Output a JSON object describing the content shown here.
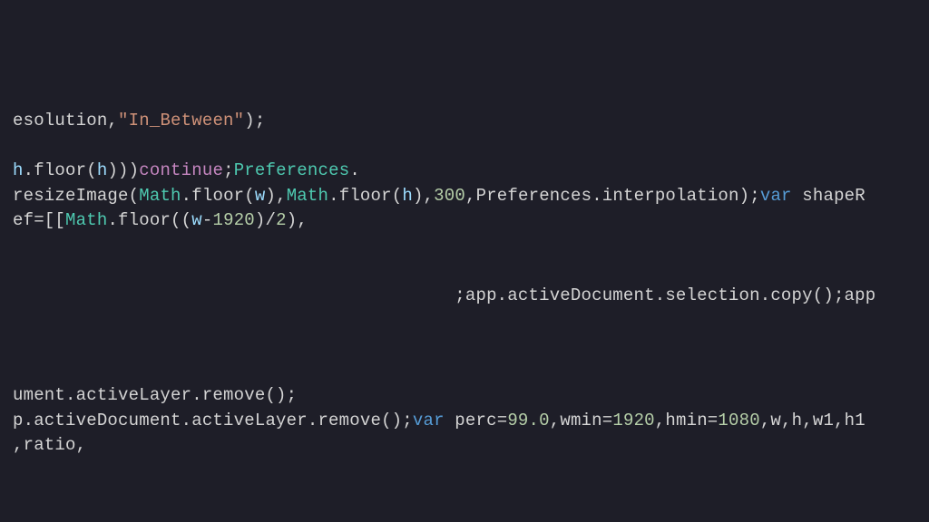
{
  "editor": {
    "lines": [
      {
        "segments": [
          {
            "cls": "tk-default",
            "text": "esolution,"
          },
          {
            "cls": "tk-string",
            "text": "\"In_Between\""
          },
          {
            "cls": "tk-default",
            "text": ");"
          }
        ]
      },
      {
        "segments": [
          {
            "cls": "tk-default",
            "text": " "
          }
        ]
      },
      {
        "segments": [
          {
            "cls": "tk-ident",
            "text": "h"
          },
          {
            "cls": "tk-default",
            "text": ".floor("
          },
          {
            "cls": "tk-ident",
            "text": "h"
          },
          {
            "cls": "tk-default",
            "text": ")))"
          },
          {
            "cls": "tk-keyword",
            "text": "continue"
          },
          {
            "cls": "tk-default",
            "text": ";"
          },
          {
            "cls": "tk-type",
            "text": "Preferences"
          },
          {
            "cls": "tk-default",
            "text": "."
          }
        ]
      },
      {
        "segments": [
          {
            "cls": "tk-default",
            "text": "resizeImage("
          },
          {
            "cls": "tk-type",
            "text": "Math"
          },
          {
            "cls": "tk-default",
            "text": ".floor("
          },
          {
            "cls": "tk-ident",
            "text": "w"
          },
          {
            "cls": "tk-default",
            "text": "),"
          },
          {
            "cls": "tk-type",
            "text": "Math"
          },
          {
            "cls": "tk-default",
            "text": ".floor("
          },
          {
            "cls": "tk-ident",
            "text": "h"
          },
          {
            "cls": "tk-default",
            "text": "),"
          },
          {
            "cls": "tk-number",
            "text": "300"
          },
          {
            "cls": "tk-default",
            "text": ",Preferences.interpolation);"
          },
          {
            "cls": "tk-var",
            "text": "var"
          },
          {
            "cls": "tk-default",
            "text": " shapeR"
          }
        ]
      },
      {
        "segments": [
          {
            "cls": "tk-default",
            "text": "ef=[["
          },
          {
            "cls": "tk-type",
            "text": "Math"
          },
          {
            "cls": "tk-default",
            "text": ".floor(("
          },
          {
            "cls": "tk-ident",
            "text": "w"
          },
          {
            "cls": "tk-default",
            "text": "-"
          },
          {
            "cls": "tk-number",
            "text": "1920"
          },
          {
            "cls": "tk-default",
            "text": ")/"
          },
          {
            "cls": "tk-number",
            "text": "2"
          },
          {
            "cls": "tk-default",
            "text": "),"
          }
        ]
      },
      {
        "segments": [
          {
            "cls": "tk-default",
            "text": " "
          }
        ]
      },
      {
        "segments": [
          {
            "cls": "tk-default",
            "text": " "
          }
        ]
      },
      {
        "segments": [
          {
            "cls": "tk-default",
            "text": "                                          ;app.activeDocument.selection.copy();app"
          }
        ]
      },
      {
        "segments": [
          {
            "cls": "tk-default",
            "text": " "
          }
        ]
      },
      {
        "segments": [
          {
            "cls": "tk-default",
            "text": " "
          }
        ]
      },
      {
        "segments": [
          {
            "cls": "tk-default",
            "text": " "
          }
        ]
      },
      {
        "segments": [
          {
            "cls": "tk-default",
            "text": "ument.activeLayer.remove();"
          }
        ]
      },
      {
        "segments": [
          {
            "cls": "tk-default",
            "text": "p.activeDocument.activeLayer.remove();"
          },
          {
            "cls": "tk-var",
            "text": "var"
          },
          {
            "cls": "tk-default",
            "text": " perc="
          },
          {
            "cls": "tk-number",
            "text": "99.0"
          },
          {
            "cls": "tk-default",
            "text": ",wmin="
          },
          {
            "cls": "tk-number",
            "text": "1920"
          },
          {
            "cls": "tk-default",
            "text": ",hmin="
          },
          {
            "cls": "tk-number",
            "text": "1080"
          },
          {
            "cls": "tk-default",
            "text": ",w,h,w1,h1"
          }
        ]
      },
      {
        "segments": [
          {
            "cls": "tk-default",
            "text": ",ratio,"
          }
        ]
      }
    ]
  }
}
